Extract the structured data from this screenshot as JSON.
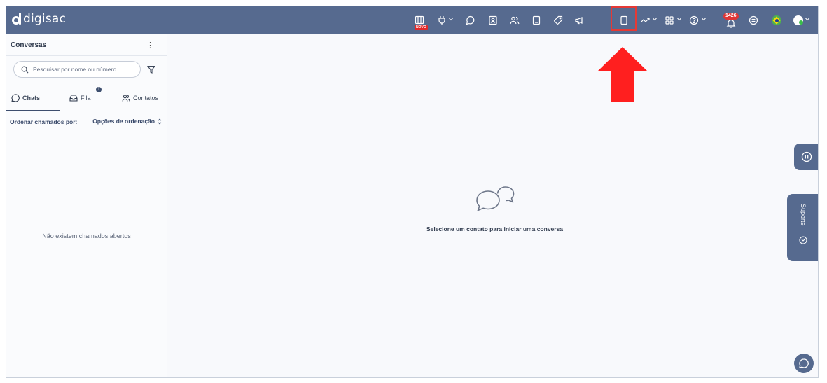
{
  "app": {
    "name": "digisac"
  },
  "topbar": {
    "icons": [
      "kanban-icon",
      "plug-icon",
      "chat-bubble-icon",
      "contacts-book-icon",
      "users-icon",
      "calculator-icon",
      "tag-icon",
      "megaphone-icon",
      "mobile-icon",
      "trend-icon",
      "apps-grid-icon",
      "help-icon",
      "bell-icon",
      "list-circle-icon",
      "flag-icon",
      "avatar-icon"
    ],
    "new_badge": "NOVO",
    "notification_count": "1426",
    "highlighted_icon": "mobile-icon"
  },
  "sidebar": {
    "title": "Conversas",
    "menu_glyph": "⋮",
    "search_placeholder": "Pesquisar por nome ou número...",
    "tabs": [
      {
        "label": "Chats",
        "active": true
      },
      {
        "label": "Fila",
        "badge": "1"
      },
      {
        "label": "Contatos"
      }
    ],
    "sort_label": "Ordenar chamados por:",
    "sort_options_label": "Opções de ordenação",
    "empty_message": "Não existem chamados abertos"
  },
  "main": {
    "empty_message": "Selecione um contato para iniciar uma conversa"
  },
  "side_panel": {
    "support_label": "Suporte"
  },
  "colors": {
    "topbar": "#566a8f",
    "highlight": "#e53935",
    "arrow": "#ff1f1f",
    "background": "#f8f9fc"
  }
}
